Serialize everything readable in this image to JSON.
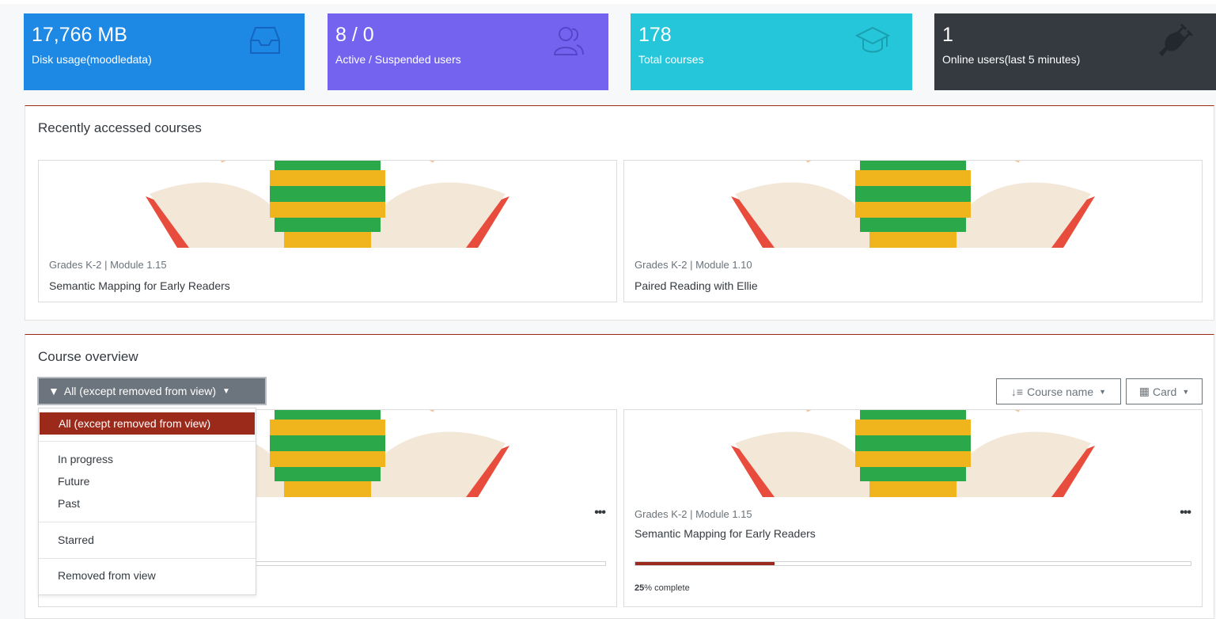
{
  "stats": [
    {
      "value": "17,766 MB",
      "label": "Disk usage(moodledata)",
      "icon": "inbox-icon",
      "color": "#1e88e5"
    },
    {
      "value": "8 / 0",
      "label": "Active / Suspended users",
      "icon": "users-icon",
      "color": "#7463ef"
    },
    {
      "value": "178",
      "label": "Total courses",
      "icon": "graduation-cap-icon",
      "color": "#26c6da"
    },
    {
      "value": "1",
      "label": "Online users(last 5 minutes)",
      "icon": "plug-icon",
      "color": "#343a40"
    }
  ],
  "recent": {
    "title": "Recently accessed courses",
    "courses": [
      {
        "category": "Grades K-2 | Module 1.15",
        "name": "Semantic Mapping for Early Readers"
      },
      {
        "category": "Grades K-2 | Module 1.10",
        "name": "Paired Reading with Ellie"
      }
    ]
  },
  "overview": {
    "title": "Course overview",
    "filter_label": "All (except removed from view)",
    "sort_label": "Course name",
    "view_label": "Card",
    "dropdown": {
      "active": "All (except removed from view)",
      "group1": [
        "In progress",
        "Future",
        "Past"
      ],
      "starred": "Starred",
      "removed": "Removed from view"
    },
    "courses": [
      {
        "category": "",
        "name": "",
        "progress": 0,
        "progress_text": ""
      },
      {
        "category": "Grades K-2 | Module 1.15",
        "name": "Semantic Mapping for Early Readers",
        "progress": 25,
        "progress_pct": "25",
        "progress_text": "% complete"
      }
    ]
  },
  "accent_color": "#9c2a1b"
}
